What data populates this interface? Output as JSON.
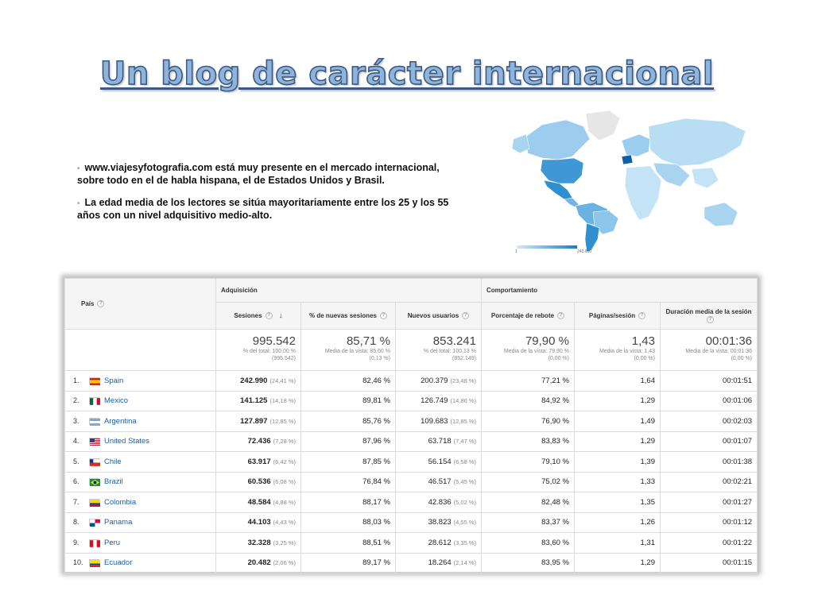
{
  "slide": {
    "title": "Un blog de carácter internacional",
    "bullets": [
      "www.viajesyfotografia.com está muy presente en el mercado internacional, sobre todo en el de habla hispana, el de Estados Unidos y Brasil.",
      "La edad media de los lectores se sitúa mayoritariamente entre los 25 y los 55 años con un nivel adquisitivo medio-alto."
    ]
  },
  "map": {
    "legend_min": "1",
    "legend_max": "242.990",
    "colors": {
      "light": "#d6eaf8",
      "mid": "#8cc6ea",
      "dark": "#2f8fd0",
      "inactive": "#e6e6e6"
    }
  },
  "report": {
    "groups": {
      "pais": "País",
      "adquisicion": "Adquisición",
      "comportamiento": "Comportamiento"
    },
    "columns": {
      "sesiones": "Sesiones",
      "nuevas": "% de nuevas sesiones",
      "nuevos_usuarios": "Nuevos usuarios",
      "rebote": "Porcentaje de rebote",
      "paginas": "Páginas/sesión",
      "duracion": "Duración media de la sesión"
    },
    "totals": {
      "sesiones": {
        "value": "995.542",
        "sub1": "% del total: 100,00 %",
        "sub2": "(995.542)"
      },
      "nuevas": {
        "value": "85,71 %",
        "sub1": "Media de la vista: 85,60 %",
        "sub2": "(0,13 %)"
      },
      "nuevos_usuarios": {
        "value": "853.241",
        "sub1": "% del total: 100,13 %",
        "sub2": "(852.149)"
      },
      "rebote": {
        "value": "79,90 %",
        "sub1": "Media de la vista: 79,90 %",
        "sub2": "(0,00 %)"
      },
      "paginas": {
        "value": "1,43",
        "sub1": "Media de la vista: 1,43",
        "sub2": "(0,00 %)"
      },
      "duracion": {
        "value": "00:01:36",
        "sub1": "Media de la vista: 00:01:36",
        "sub2": "(0,00 %)"
      }
    },
    "rows": [
      {
        "idx": "1.",
        "country": "Spain",
        "sesiones": "242.990",
        "ses_pct": "(24,41 %)",
        "nuevas": "82,46 %",
        "usuarios": "200.379",
        "usu_pct": "(23,48 %)",
        "rebote": "77,21 %",
        "paginas": "1,64",
        "duracion": "00:01:51"
      },
      {
        "idx": "2.",
        "country": "Mexico",
        "sesiones": "141.125",
        "ses_pct": "(14,18 %)",
        "nuevas": "89,81 %",
        "usuarios": "126.749",
        "usu_pct": "(14,86 %)",
        "rebote": "84,92 %",
        "paginas": "1,29",
        "duracion": "00:01:06"
      },
      {
        "idx": "3.",
        "country": "Argentina",
        "sesiones": "127.897",
        "ses_pct": "(12,85 %)",
        "nuevas": "85,76 %",
        "usuarios": "109.683",
        "usu_pct": "(12,85 %)",
        "rebote": "76,90 %",
        "paginas": "1,49",
        "duracion": "00:02:03"
      },
      {
        "idx": "4.",
        "country": "United States",
        "sesiones": "72.436",
        "ses_pct": "(7,28 %)",
        "nuevas": "87,96 %",
        "usuarios": "63.718",
        "usu_pct": "(7,47 %)",
        "rebote": "83,83 %",
        "paginas": "1,29",
        "duracion": "00:01:07"
      },
      {
        "idx": "5.",
        "country": "Chile",
        "sesiones": "63.917",
        "ses_pct": "(6,42 %)",
        "nuevas": "87,85 %",
        "usuarios": "56.154",
        "usu_pct": "(6,58 %)",
        "rebote": "79,10 %",
        "paginas": "1,39",
        "duracion": "00:01:38"
      },
      {
        "idx": "6.",
        "country": "Brazil",
        "sesiones": "60.536",
        "ses_pct": "(6,08 %)",
        "nuevas": "76,84 %",
        "usuarios": "46.517",
        "usu_pct": "(5,45 %)",
        "rebote": "75,02 %",
        "paginas": "1,33",
        "duracion": "00:02:21"
      },
      {
        "idx": "7.",
        "country": "Colombia",
        "sesiones": "48.584",
        "ses_pct": "(4,88 %)",
        "nuevas": "88,17 %",
        "usuarios": "42.836",
        "usu_pct": "(5,02 %)",
        "rebote": "82,48 %",
        "paginas": "1,35",
        "duracion": "00:01:27"
      },
      {
        "idx": "8.",
        "country": "Panama",
        "sesiones": "44.103",
        "ses_pct": "(4,43 %)",
        "nuevas": "88,03 %",
        "usuarios": "38.823",
        "usu_pct": "(4,55 %)",
        "rebote": "83,37 %",
        "paginas": "1,26",
        "duracion": "00:01:12"
      },
      {
        "idx": "9.",
        "country": "Peru",
        "sesiones": "32.328",
        "ses_pct": "(3,25 %)",
        "nuevas": "88,51 %",
        "usuarios": "28.612",
        "usu_pct": "(3,35 %)",
        "rebote": "83,60 %",
        "paginas": "1,31",
        "duracion": "00:01:22"
      },
      {
        "idx": "10.",
        "country": "Ecuador",
        "sesiones": "20.482",
        "ses_pct": "(2,06 %)",
        "nuevas": "89,17 %",
        "usuarios": "18.264",
        "usu_pct": "(2,14 %)",
        "rebote": "83,95 %",
        "paginas": "1,29",
        "duracion": "00:01:15"
      }
    ],
    "flag_icons": [
      "flag-spain-icon",
      "flag-mexico-icon",
      "flag-argentina-icon",
      "flag-united-states-icon",
      "flag-chile-icon",
      "flag-brazil-icon",
      "flag-colombia-icon",
      "flag-panama-icon",
      "flag-peru-icon",
      "flag-ecuador-icon"
    ]
  }
}
